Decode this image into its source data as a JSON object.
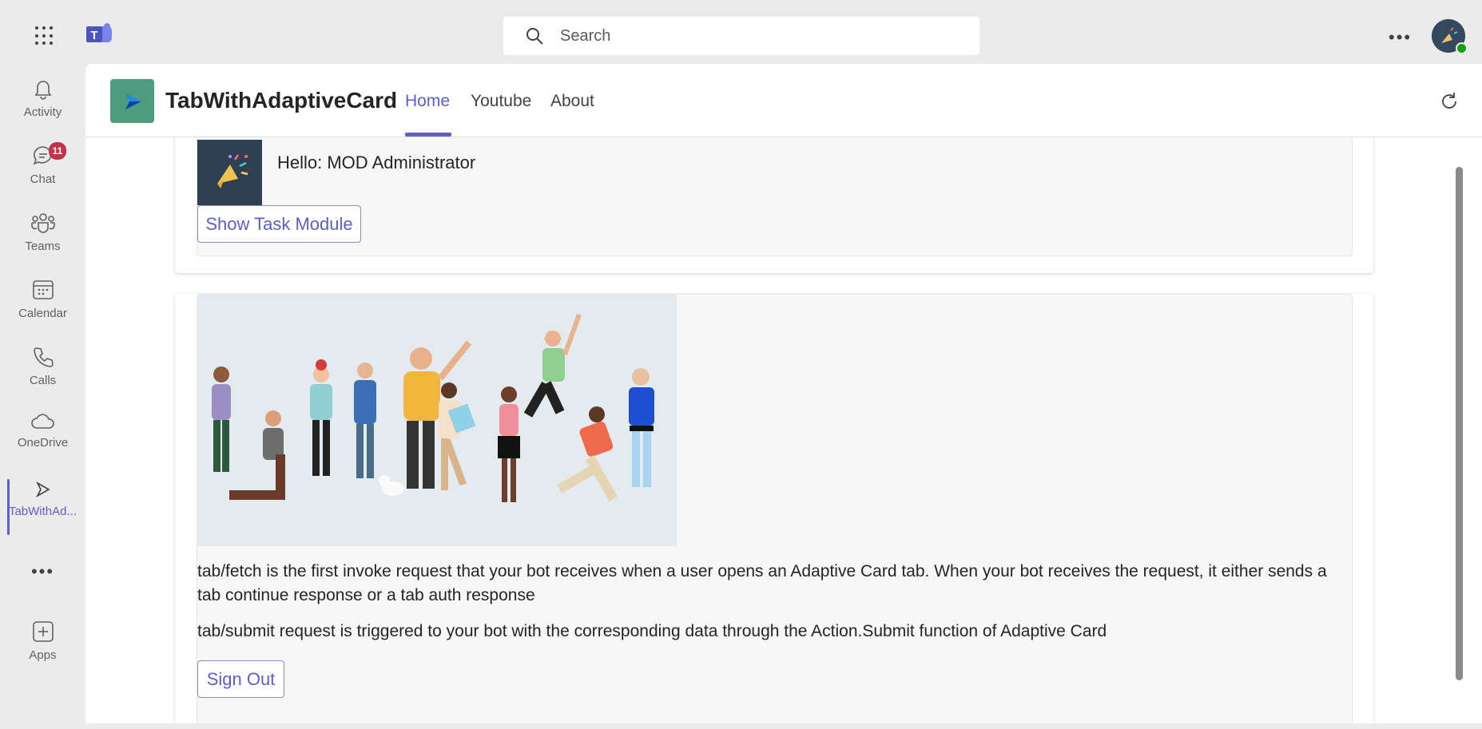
{
  "search": {
    "placeholder": "Search"
  },
  "rail": {
    "items": [
      {
        "label": "Activity",
        "icon": "bell-icon"
      },
      {
        "label": "Chat",
        "icon": "chat-icon",
        "badge": "11"
      },
      {
        "label": "Teams",
        "icon": "teams-icon"
      },
      {
        "label": "Calendar",
        "icon": "calendar-icon"
      },
      {
        "label": "Calls",
        "icon": "phone-icon"
      },
      {
        "label": "OneDrive",
        "icon": "cloud-icon"
      },
      {
        "label": "TabWithAd...",
        "icon": "app-icon"
      },
      {
        "label": "Apps",
        "icon": "add-apps-icon"
      }
    ]
  },
  "app": {
    "title": "TabWithAdaptiveCard",
    "tabs": [
      {
        "label": "Home",
        "active": true
      },
      {
        "label": "Youtube",
        "active": false
      },
      {
        "label": "About",
        "active": false
      }
    ]
  },
  "card1": {
    "hello": "Hello: MOD Administrator",
    "button": "Show Task Module"
  },
  "card2": {
    "para1": "tab/fetch is the first invoke request that your bot receives when a user opens an Adaptive Card tab. When your bot receives the request, it either sends a tab continue response or a tab auth response",
    "para2": "tab/submit request is triggered to your bot with the corresponding data through the Action.Submit function of Adaptive Card",
    "button": "Sign Out"
  },
  "colors": {
    "accent": "#5b5fc7",
    "badge": "#c4314b",
    "presence": "#13a10e"
  }
}
